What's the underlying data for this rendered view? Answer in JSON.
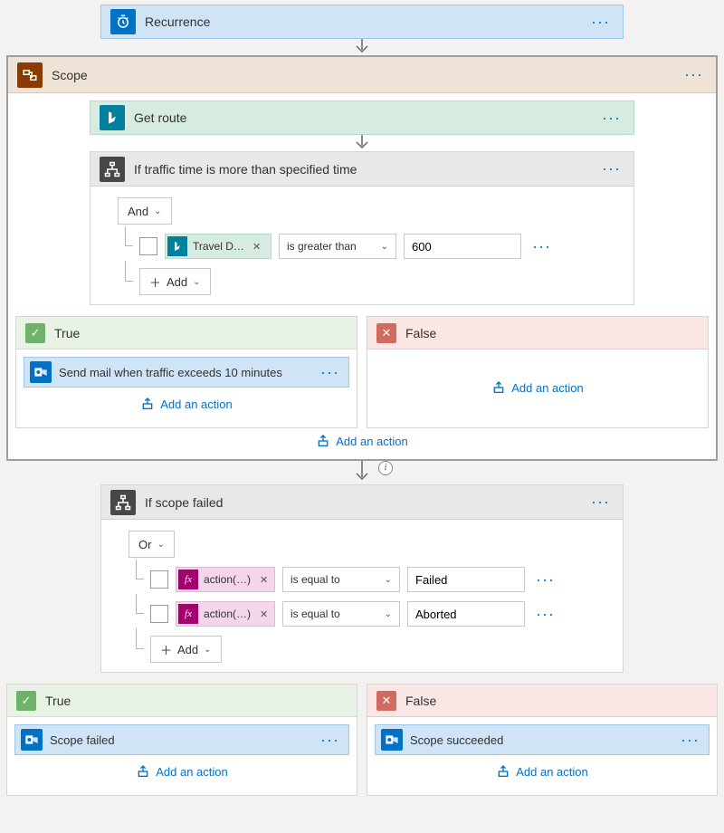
{
  "recurrence": {
    "title": "Recurrence"
  },
  "scope": {
    "title": "Scope",
    "getRoute": {
      "title": "Get route"
    },
    "ifTraffic": {
      "title": "If traffic time is more than specified time",
      "logicOp": "And",
      "tokenLabel": "Travel D…",
      "operator": "is greater than",
      "value": "600",
      "addLabel": "Add"
    },
    "trueBranch": {
      "title": "True",
      "action": {
        "title": "Send mail when traffic exceeds 10 minutes"
      },
      "addAction": "Add an action"
    },
    "falseBranch": {
      "title": "False",
      "addAction": "Add an action"
    },
    "addAction": "Add an action"
  },
  "ifScopeFailed": {
    "title": "If scope failed",
    "logicOp": "Or",
    "rows": [
      {
        "tokenLabel": "action(…)",
        "operator": "is equal to",
        "value": "Failed"
      },
      {
        "tokenLabel": "action(…)",
        "operator": "is equal to",
        "value": "Aborted"
      }
    ],
    "addLabel": "Add"
  },
  "outerTrue": {
    "title": "True",
    "action": {
      "title": "Scope failed"
    },
    "addAction": "Add an action"
  },
  "outerFalse": {
    "title": "False",
    "action": {
      "title": "Scope succeeded"
    },
    "addAction": "Add an action"
  }
}
